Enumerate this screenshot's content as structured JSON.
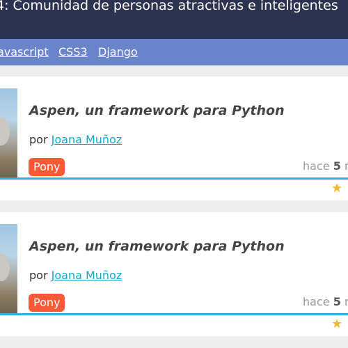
{
  "header": {
    "title": "4: Comunidad de personas atractivas e inteligentes"
  },
  "nav": {
    "items": [
      "avascript",
      "CSS3",
      "Django"
    ]
  },
  "posts": [
    {
      "title": "Aspen, un framework para Python",
      "by": "por",
      "author": "Joana Muñoz",
      "tag": "Pony",
      "time_prefix": "hace",
      "time_value": "5",
      "time_unit": "m",
      "star": "★"
    },
    {
      "title": "Aspen, un framework para Python",
      "by": "por",
      "author": "Joana Muñoz",
      "tag": "Pony",
      "time_prefix": "hace",
      "time_value": "5",
      "time_unit": "m",
      "star": "★"
    }
  ],
  "colors": {
    "header_bg": "#2c3350",
    "nav_bg": "#6a84cc",
    "accent": "#29b6d6",
    "tag_bg": "#fb5a36",
    "star": "#f5b82a"
  }
}
